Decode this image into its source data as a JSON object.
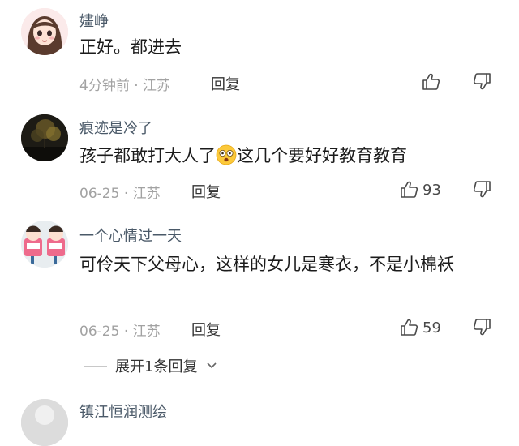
{
  "comments": [
    {
      "username": "嫿峥",
      "text_before": "正好。都进去",
      "text_after": "",
      "has_emoji": false,
      "time": "4分钟前",
      "location": "江苏",
      "reply_label": "回复",
      "like_count": "",
      "avatar_icon": "girl-avatar"
    },
    {
      "username": "痕迹是冷了",
      "text_before": "孩子都敢打大人了",
      "text_after": "这几个要好好教育教育",
      "has_emoji": true,
      "time": "06-25",
      "location": "江苏",
      "reply_label": "回复",
      "like_count": "93",
      "avatar_icon": "night-scene-avatar"
    },
    {
      "username": "一个心情过一天",
      "text_before": "可伶天下父母心，这样的女儿是寒衣，不是小棉袄",
      "text_after": "",
      "has_emoji": false,
      "time": "06-25",
      "location": "江苏",
      "reply_label": "回复",
      "like_count": "59",
      "avatar_icon": "cartoon-avatar"
    },
    {
      "username": "镇江恒润测绘",
      "avatar_icon": "partial-avatar"
    }
  ],
  "expand_replies": "展开1条回复",
  "meta_separator": "·",
  "colors": {
    "username": "#4a5968",
    "meta": "#a2a2a2",
    "text": "#1b1b1b"
  }
}
